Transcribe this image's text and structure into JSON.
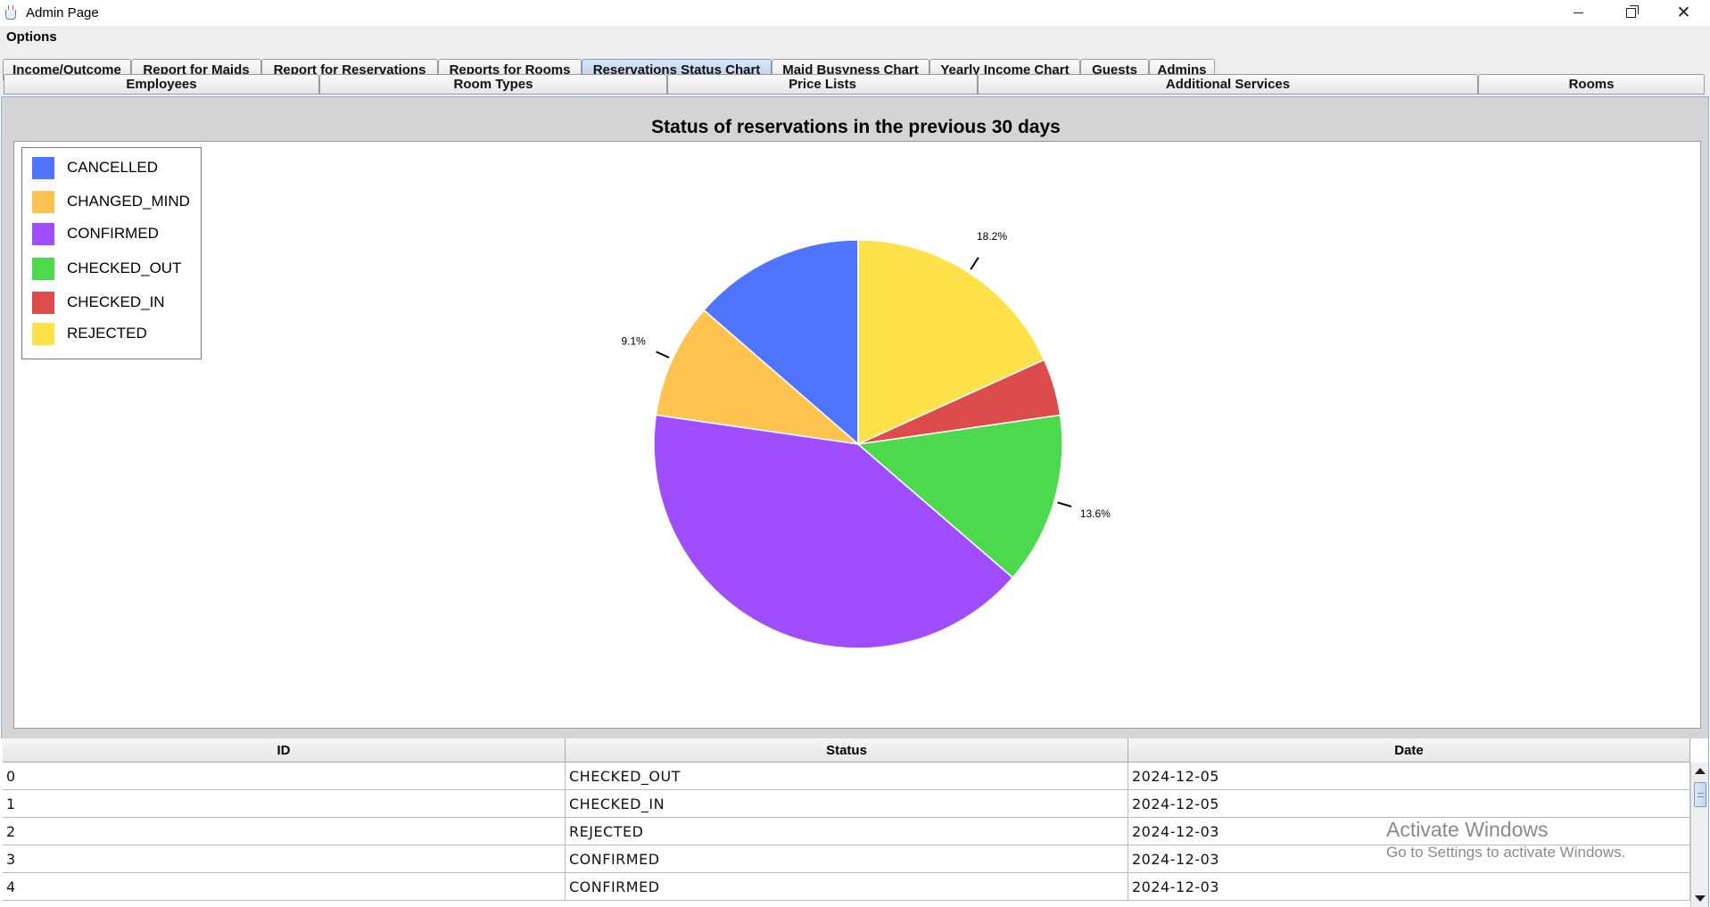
{
  "window": {
    "title": "Admin Page"
  },
  "menu": {
    "items": [
      "Options"
    ]
  },
  "tabs_row1": [
    {
      "label": "Income/Outcome",
      "selected": false
    },
    {
      "label": "Report for Maids",
      "selected": false
    },
    {
      "label": "Report for Reservations",
      "selected": false
    },
    {
      "label": "Reports for Rooms",
      "selected": false
    },
    {
      "label": "Reservations Status Chart",
      "selected": true
    },
    {
      "label": "Maid Busyness Chart",
      "selected": false
    },
    {
      "label": "Yearly Income Chart",
      "selected": false
    },
    {
      "label": "Guests",
      "selected": false
    },
    {
      "label": "Admins",
      "selected": false
    }
  ],
  "tabs_row2": [
    {
      "label": "Employees"
    },
    {
      "label": "Room Types"
    },
    {
      "label": "Price Lists"
    },
    {
      "label": "Additional Services"
    },
    {
      "label": "Rooms"
    }
  ],
  "chart_data": {
    "type": "pie",
    "title": "Status of reservations in the previous 30 days",
    "legend_position": "top-left",
    "slices": [
      {
        "name": "CANCELLED",
        "value": 13.6,
        "color": "#4f74ff",
        "label": ""
      },
      {
        "name": "CHANGED_MIND",
        "value": 9.1,
        "color": "#ffc34f",
        "label": "9.1%"
      },
      {
        "name": "CONFIRMED",
        "value": 40.9,
        "color": "#a04cff",
        "label": ""
      },
      {
        "name": "CHECKED_OUT",
        "value": 13.6,
        "color": "#4dd94d",
        "label": "13.6%"
      },
      {
        "name": "CHECKED_IN",
        "value": 4.5,
        "color": "#dd4c4c",
        "label": ""
      },
      {
        "name": "REJECTED",
        "value": 18.2,
        "color": "#ffe14a",
        "label": "18.2%"
      }
    ]
  },
  "table": {
    "columns": [
      "ID",
      "Status",
      "Date"
    ],
    "rows": [
      [
        "0",
        "CHECKED_OUT",
        "2024-12-05"
      ],
      [
        "1",
        "CHECKED_IN",
        "2024-12-05"
      ],
      [
        "2",
        "REJECTED",
        "2024-12-03"
      ],
      [
        "3",
        "CONFIRMED",
        "2024-12-03"
      ],
      [
        "4",
        "CONFIRMED",
        "2024-12-03"
      ]
    ]
  },
  "watermark": {
    "title": "Activate Windows",
    "subtitle": "Go to Settings to activate Windows."
  }
}
